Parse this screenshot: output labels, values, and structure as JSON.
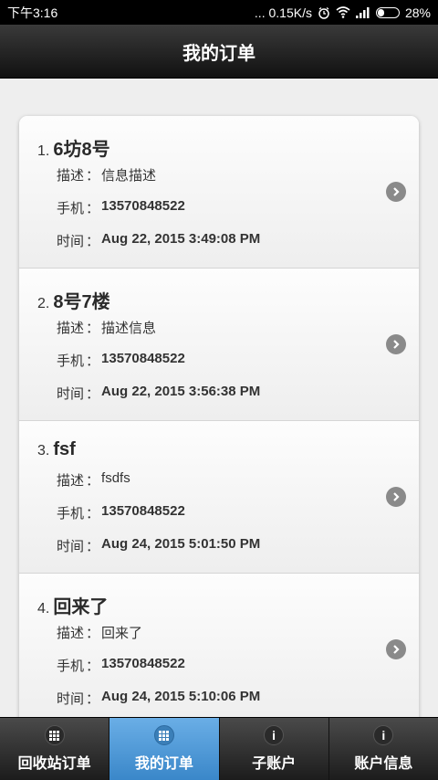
{
  "status_bar": {
    "time": "下午3:16",
    "network_speed": "... 0.15K/s",
    "battery": "28%",
    "icons": [
      "alarm-icon",
      "wifi-icon",
      "signal-icon",
      "battery-icon"
    ]
  },
  "header": {
    "title": "我的订单"
  },
  "orders": [
    {
      "index": "1.",
      "name": "6坊8号",
      "desc_label": "描述",
      "desc": "信息描述",
      "phone_label": "手机",
      "phone": "13570848522",
      "time_label": "时间",
      "time": "Aug 22, 2015 3:49:08 PM"
    },
    {
      "index": "2.",
      "name": "8号7楼",
      "desc_label": "描述",
      "desc": "描述信息",
      "phone_label": "手机",
      "phone": "13570848522",
      "time_label": "时间",
      "time": "Aug 22, 2015 3:56:38 PM"
    },
    {
      "index": "3.",
      "name": "fsf",
      "desc_label": "描述",
      "desc": "fsdfs",
      "phone_label": "手机",
      "phone": "13570848522",
      "time_label": "时间",
      "time": "Aug 24, 2015 5:01:50 PM"
    },
    {
      "index": "4.",
      "name": "回来了",
      "desc_label": "描述",
      "desc": "回来了",
      "phone_label": "手机",
      "phone": "13570848522",
      "time_label": "时间",
      "time": "Aug 24, 2015 5:10:06 PM"
    }
  ],
  "separator": "：",
  "tabs": [
    {
      "label": "回收站订单",
      "icon": "grid-icon",
      "active": false
    },
    {
      "label": "我的订单",
      "icon": "grid-icon",
      "active": true
    },
    {
      "label": "子账户",
      "icon": "info-icon",
      "active": false
    },
    {
      "label": "账户信息",
      "icon": "info-icon",
      "active": false
    }
  ],
  "colors": {
    "active_tab": "#4a98d8",
    "header_bg": "#1a1a1a"
  }
}
